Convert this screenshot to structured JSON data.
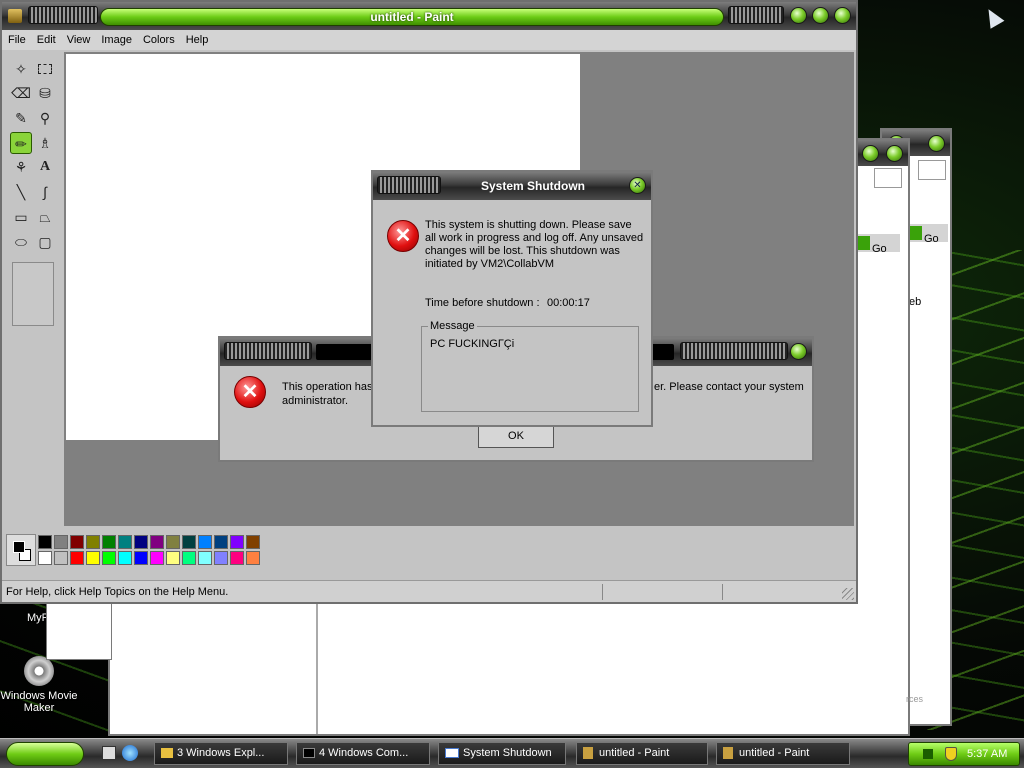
{
  "paint": {
    "title": "untitled - Paint",
    "menu": [
      "File",
      "Edit",
      "View",
      "Image",
      "Colors",
      "Help"
    ],
    "status_text": "For Help, click Help Topics on the Help Menu.",
    "palette_row1": [
      "#000000",
      "#808080",
      "#800000",
      "#808000",
      "#008000",
      "#008080",
      "#000080",
      "#800080",
      "#808040",
      "#004040",
      "#0080ff",
      "#004080",
      "#8000ff",
      "#804000"
    ],
    "palette_row2": [
      "#ffffff",
      "#c0c0c0",
      "#ff0000",
      "#ffff00",
      "#00ff00",
      "#00ffff",
      "#0000ff",
      "#ff00ff",
      "#ffff80",
      "#00ff80",
      "#80ffff",
      "#8080ff",
      "#ff0080",
      "#ff8040"
    ]
  },
  "shutdown_dialog": {
    "title": "System Shutdown",
    "message": "This system is shutting down. Please save all work in progress and log off. Any unsaved changes will be lost. This shutdown was initiated by VM2\\CollabVM",
    "time_label": "Time before shutdown :",
    "time_value": "00:00:17",
    "group_label": "Message",
    "group_text": "PC FUCKINGГÇi"
  },
  "error_dialog": {
    "text_left": "This operation has",
    "text_right": "er. Please contact your system",
    "text_line2": "administrator.",
    "ok_label": "OK"
  },
  "background": {
    "go_label_1": "Go",
    "go_label_2": "Go",
    "eb_text": "eb",
    "rces_text": "rces"
  },
  "desktop": {
    "icon_my_partial": "MyP",
    "icon_movie_maker": "Windows Movie Maker"
  },
  "taskbar": {
    "buttons": [
      "3 Windows Expl...",
      "4 Windows Com...",
      "System Shutdown",
      "untitled - Paint",
      "untitled - Paint"
    ],
    "clock": "5:37 AM"
  }
}
